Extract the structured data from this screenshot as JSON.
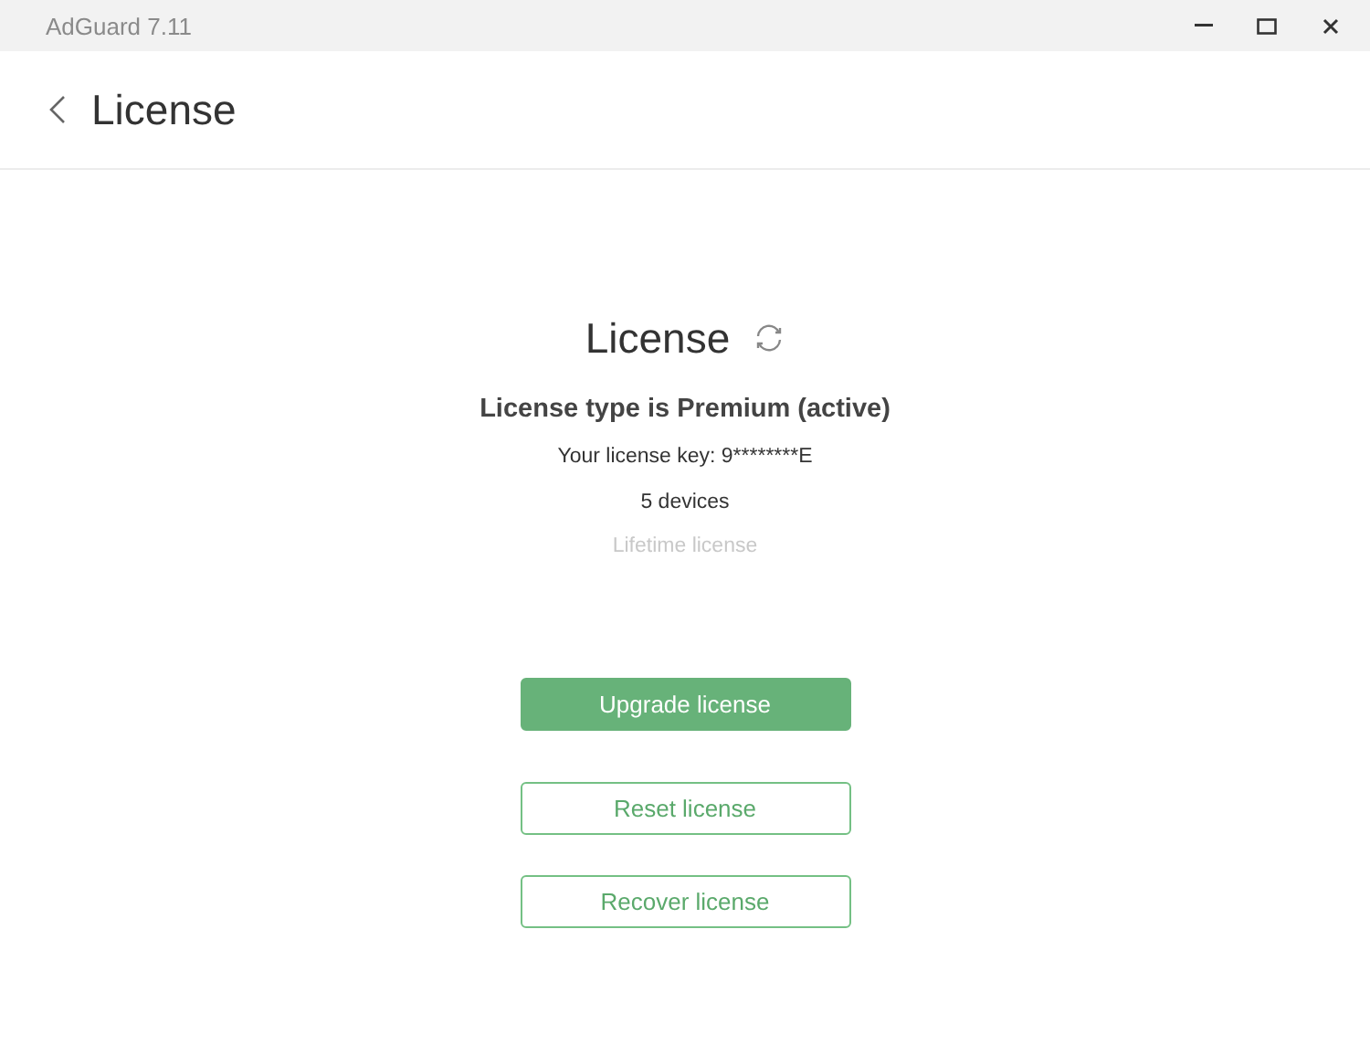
{
  "window": {
    "title": "AdGuard 7.11"
  },
  "header": {
    "title": "License"
  },
  "license": {
    "heading": "License",
    "type_line": "License type is Premium (active)",
    "key_line": "Your license key: 9********E",
    "devices": "5 devices",
    "term": "Lifetime license"
  },
  "buttons": [
    {
      "label": "Upgrade license",
      "kind": "primary"
    },
    {
      "label": "Reset license",
      "kind": "outline"
    },
    {
      "label": "Recover license",
      "kind": "outline"
    }
  ]
}
